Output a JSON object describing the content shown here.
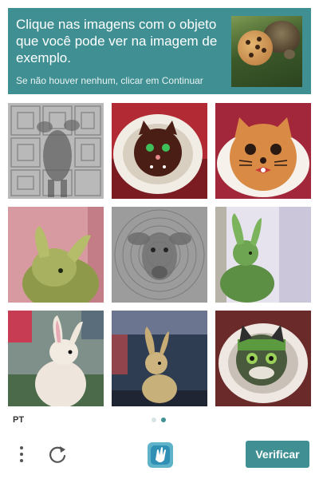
{
  "header": {
    "prompt": "Clique nas imagens com o objeto que você pode ver na imagem de exemplo.",
    "hint": "Se não houver nenhum, clicar em Continuar",
    "background_color": "#3f8f93"
  },
  "example_image": {
    "content": "cookie and turtle"
  },
  "tiles": [
    {
      "content": "distorted sheep on patterned background"
    },
    {
      "content": "cat face cookie on plate"
    },
    {
      "content": "cat face cookie"
    },
    {
      "content": "green bunny"
    },
    {
      "content": "distorted sheep"
    },
    {
      "content": "green bunny"
    },
    {
      "content": "bunny"
    },
    {
      "content": "bunny"
    },
    {
      "content": "cat face cookie on plate"
    }
  ],
  "footer": {
    "language": "PT",
    "pagination": {
      "total": 2,
      "active": 2
    }
  },
  "bottom": {
    "menu_icon": "more-vertical-icon",
    "refresh_icon": "refresh-icon",
    "logo_icon": "hcaptcha-logo-icon",
    "verify_label": "Verificar",
    "accent_color": "#3f8f93"
  }
}
